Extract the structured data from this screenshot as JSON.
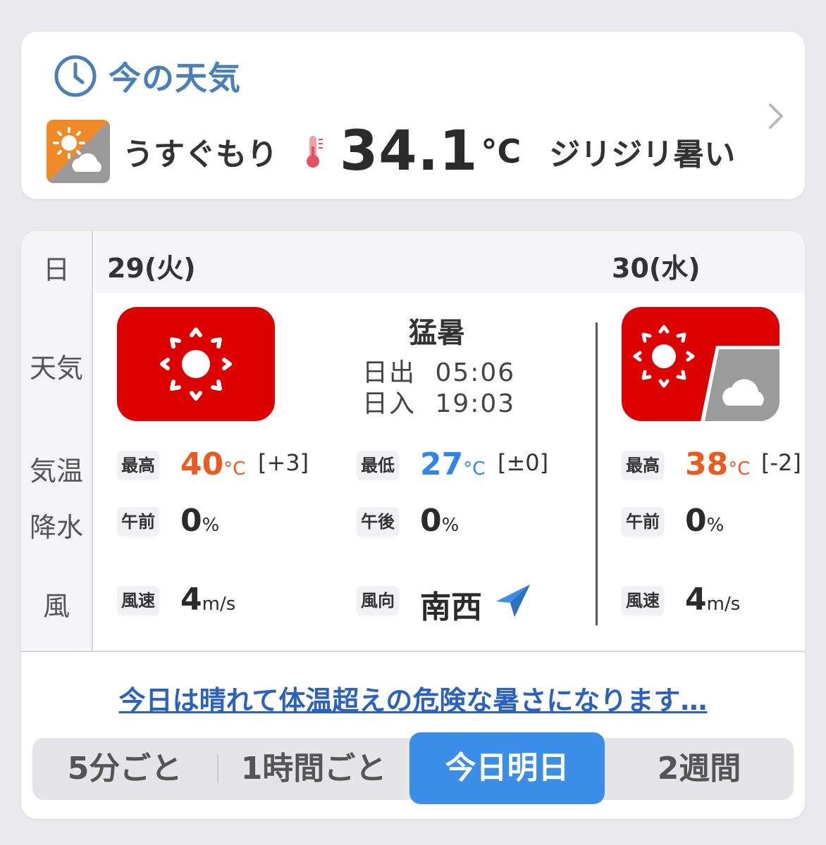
{
  "now": {
    "title": "今の天気",
    "condition": "うすぐもり",
    "temperature": "34.1",
    "unit": "°C",
    "feeling": "ジリジリ暑い",
    "icons": [
      "clock-icon",
      "sunny-then-cloudy-icon",
      "thermometer-icon",
      "chevron-right-icon"
    ]
  },
  "forecast": {
    "side_labels": {
      "day": "日",
      "weather": "天気",
      "temperature": "気温",
      "precip": "降水",
      "wind": "風"
    },
    "days": [
      {
        "date": "29(火)",
        "icon": "extreme-sun-icon",
        "summary": "猛暑",
        "sunrise_label": "日出",
        "sunrise": "05:06",
        "sunset_label": "日入",
        "sunset": "19:03",
        "high_label": "最高",
        "high": "40",
        "high_diff": "[+3]",
        "low_label": "最低",
        "low": "27",
        "low_diff": "[±0]",
        "am_label": "午前",
        "am_precip": "0",
        "pm_label": "午後",
        "pm_precip": "0",
        "wind_speed_label": "風速",
        "wind_speed": "4",
        "wind_dir_label": "風向",
        "wind_dir": "南西"
      },
      {
        "date": "30(水)",
        "icon": "extreme-sun-then-cloudy-icon",
        "high_label": "最高",
        "high": "38",
        "high_diff": "[-2]",
        "am_label": "午前",
        "am_precip": "0",
        "wind_speed_label": "風速",
        "wind_speed": "4"
      }
    ],
    "units": {
      "temp": "°C",
      "precip": "%",
      "wind": "m/s"
    },
    "link_text": "今日は晴れて体温超えの危険な暑さになります…",
    "tabs": [
      "5分ごと",
      "1時間ごと",
      "今日明日",
      "2週間"
    ],
    "active_tab": "今日明日"
  },
  "colors": {
    "accent_blue": "#3b8ee8",
    "title_blue": "#4a7fb8",
    "hot": "#ec5a1e",
    "cold": "#2f86e8",
    "extreme_red": "#dd0000"
  }
}
